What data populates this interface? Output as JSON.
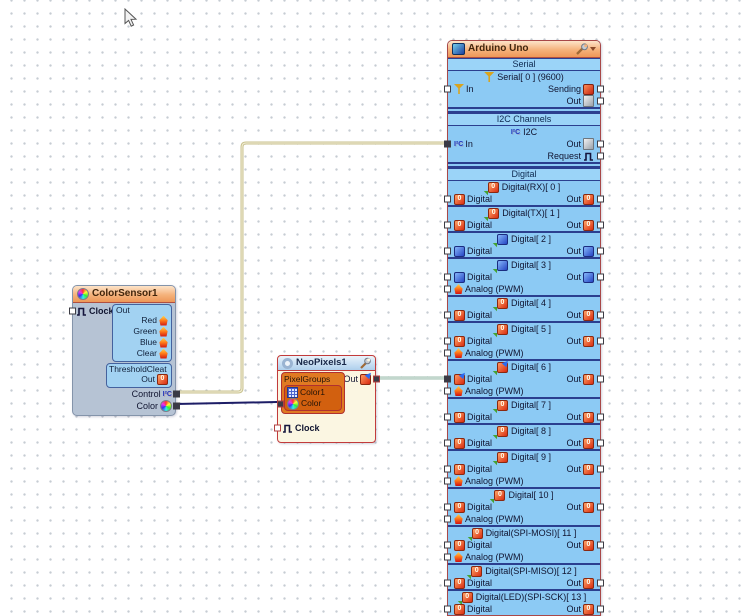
{
  "canvas": {
    "background": "#ffffff",
    "grid_dot_color": "#c6ccd3"
  },
  "cursor": {
    "name": "mouse-pointer-icon"
  },
  "icons": {
    "settings": "wrench-icon",
    "menu": "chevron-down-icon",
    "serial": "antenna-icon",
    "i2c": "i2c-icon",
    "i2c_glyph": "I²C",
    "clock": "pulse-icon",
    "analog": "flame-icon",
    "color": "color-wheel-icon",
    "pixel_grid": "grid-icon",
    "digital_red": "digital-red-icon",
    "digital_blue": "digital-blue-icon",
    "out_doc": "document-icon",
    "sending": "sending-icon",
    "arduino_header": "chip-icon",
    "neopixels_header": "ring-icon"
  },
  "wires": {
    "i2c": {
      "label": "control-to-i2c-in",
      "color": "#c9c28e",
      "core": "#f3efd9"
    },
    "rgb": {
      "label": "color-to-neopixels-color",
      "color": "#1d1d66"
    },
    "digital": {
      "label": "neopixels-out-to-digital6",
      "color": "#9cbcae",
      "core": "#e9f2ec"
    }
  },
  "colorsensor": {
    "title": "ColorSensor1",
    "clock_label": "Clock",
    "out_panel": {
      "label": "Out",
      "pins": [
        "Red",
        "Green",
        "Blue",
        "Clear"
      ]
    },
    "threshold_panel": {
      "label": "ThresholdCleat",
      "out_label": "Out"
    },
    "control_label": "Control",
    "color_label": "Color"
  },
  "neopixels": {
    "title": "NeoPixels1",
    "out_label": "Out",
    "pixelgroups_label": "PixelGroups",
    "color1_label": "Color1",
    "color_label": "Color",
    "clock_label": "Clock"
  },
  "arduino": {
    "title": "Arduino Uno",
    "serial": {
      "section_label": "Serial",
      "channel_label": "Serial[ 0 ] (9600)",
      "in_label": "In",
      "sending_label": "Sending",
      "out_label": "Out"
    },
    "i2c": {
      "section_label": "I2C Channels",
      "channel_label": "I2C",
      "in_label": "In",
      "out_label": "Out",
      "request_label": "Request"
    },
    "digital": {
      "section_label": "Digital",
      "pin_label": "Digital",
      "out_label": "Out",
      "analog_label": "Analog (PWM)",
      "channels": [
        {
          "label": "Digital(RX)[ 0 ]",
          "style": "red",
          "out_style": "red",
          "analog": false,
          "connected": false
        },
        {
          "label": "Digital(TX)[ 1 ]",
          "style": "red",
          "out_style": "red",
          "analog": false,
          "connected": false
        },
        {
          "label": "Digital[ 2 ]",
          "style": "blue",
          "out_style": "blue",
          "analog": false,
          "connected": false
        },
        {
          "label": "Digital[ 3 ]",
          "style": "blue",
          "out_style": "blue",
          "analog": true,
          "connected": false
        },
        {
          "label": "Digital[ 4 ]",
          "style": "red",
          "out_style": "red",
          "analog": false,
          "connected": false
        },
        {
          "label": "Digital[ 5 ]",
          "style": "red",
          "out_style": "red",
          "analog": true,
          "connected": false
        },
        {
          "label": "Digital[ 6 ]",
          "style": "link",
          "out_style": "red",
          "analog": true,
          "connected": true
        },
        {
          "label": "Digital[ 7 ]",
          "style": "red",
          "out_style": "red",
          "analog": false,
          "connected": false
        },
        {
          "label": "Digital[ 8 ]",
          "style": "red",
          "out_style": "red",
          "analog": false,
          "connected": false
        },
        {
          "label": "Digital[ 9 ]",
          "style": "red",
          "out_style": "red",
          "analog": true,
          "connected": false
        },
        {
          "label": "Digital[ 10 ]",
          "style": "red",
          "out_style": "red",
          "analog": true,
          "connected": false
        },
        {
          "label": "Digital(SPI-MOSI)[ 11 ]",
          "style": "red",
          "out_style": "red",
          "analog": true,
          "connected": false
        },
        {
          "label": "Digital(SPI-MISO)[ 12 ]",
          "style": "red",
          "out_style": "red",
          "analog": false,
          "connected": false
        },
        {
          "label": "Digital(LED)(SPI-SCK)[ 13 ]",
          "style": "red",
          "out_style": "red",
          "analog": false,
          "connected": false
        }
      ]
    }
  }
}
